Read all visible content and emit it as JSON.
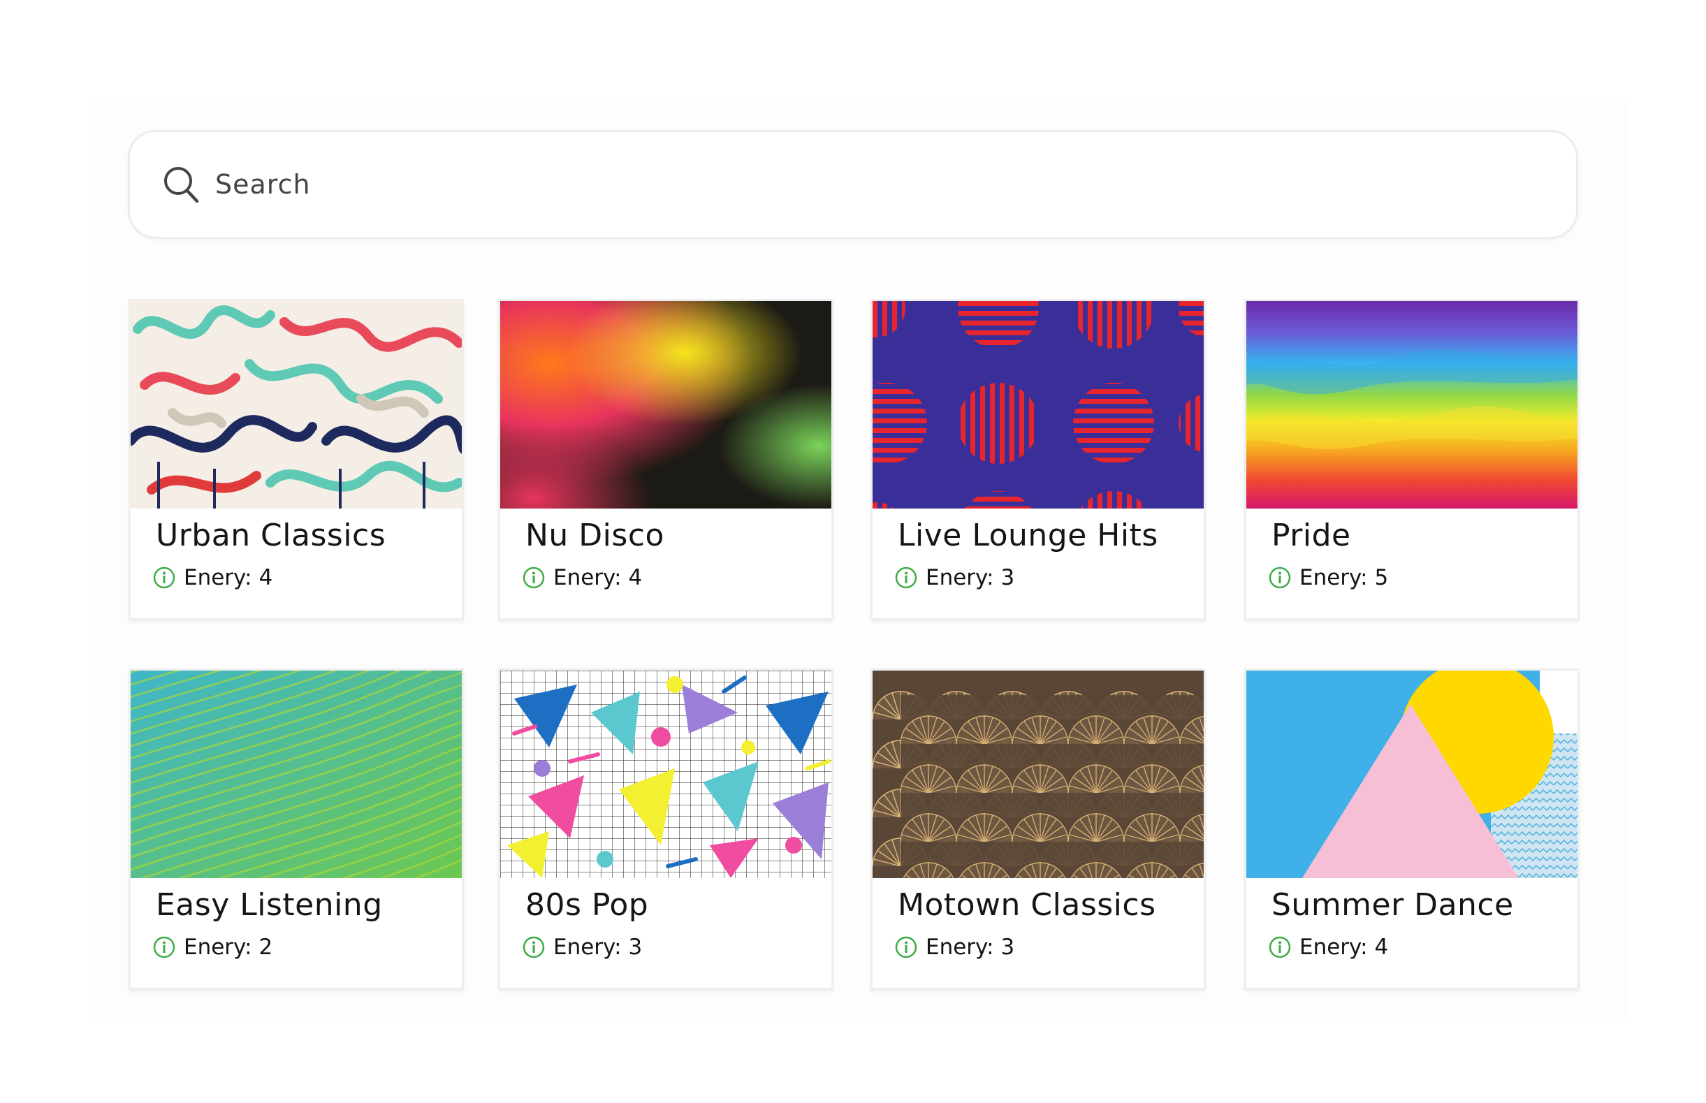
{
  "search": {
    "placeholder": "Search"
  },
  "playlists": [
    {
      "title": "Urban Classics",
      "energy_label": "Enery: 4",
      "energy": 4
    },
    {
      "title": "Nu Disco",
      "energy_label": "Enery: 4",
      "energy": 4
    },
    {
      "title": "Live Lounge Hits",
      "energy_label": "Enery: 3",
      "energy": 3
    },
    {
      "title": "Pride",
      "energy_label": "Enery: 5",
      "energy": 5
    },
    {
      "title": "Easy Listening",
      "energy_label": "Enery: 2",
      "energy": 2
    },
    {
      "title": "80s Pop",
      "energy_label": "Enery: 3",
      "energy": 3
    },
    {
      "title": "Motown Classics",
      "energy_label": "Enery: 3",
      "energy": 3
    },
    {
      "title": "Summer Dance",
      "energy_label": "Enery: 4",
      "energy": 4
    }
  ],
  "colors": {
    "info_accent": "#3dab46",
    "border": "#eeeeee"
  },
  "icons": {
    "search": "search-icon",
    "info": "info-icon"
  }
}
